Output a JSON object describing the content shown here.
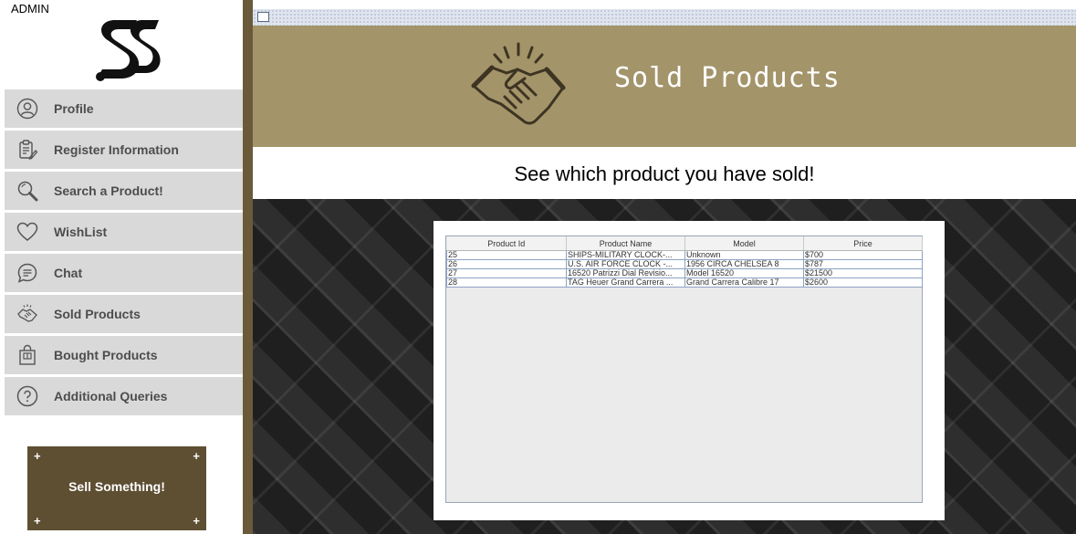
{
  "sidebar": {
    "user_label": "ADMIN",
    "items": [
      {
        "label": "Profile",
        "icon": "user-icon"
      },
      {
        "label": "Register Information",
        "icon": "clipboard-icon"
      },
      {
        "label": "Search a Product!",
        "icon": "search-icon"
      },
      {
        "label": "WishList",
        "icon": "heart-icon"
      },
      {
        "label": "Chat",
        "icon": "chat-icon"
      },
      {
        "label": "Sold Products",
        "icon": "handshake-icon"
      },
      {
        "label": "Bought Products",
        "icon": "shopping-bag-icon"
      },
      {
        "label": "Additional Queries",
        "icon": "question-icon"
      }
    ],
    "sell_button_label": "Sell Something!"
  },
  "header": {
    "title": "Sold Products",
    "subtitle": "See which product you have sold!"
  },
  "table": {
    "columns": [
      "Product Id",
      "Product Name",
      "Model",
      "Price"
    ],
    "rows": [
      [
        "25",
        "SHIPS-MILITARY CLOCK-...",
        "Unknown",
        "$700"
      ],
      [
        "26",
        "U.S. AIR FORCE CLOCK -...",
        "1956 CIRCA CHELSEA 8",
        "$787"
      ],
      [
        "27",
        "16520 Patrizzi Dial Revisio...",
        "Model 16520",
        "$21500"
      ],
      [
        "28",
        "TAG Heuer Grand Carrera ...",
        "Grand Carrera Calibre 17",
        "$2600"
      ]
    ]
  },
  "colors": {
    "banner": "#a3946a",
    "sell_button": "#5e4f33",
    "nav_item": "#d9d9d9",
    "divider": "#6b5a3a"
  }
}
